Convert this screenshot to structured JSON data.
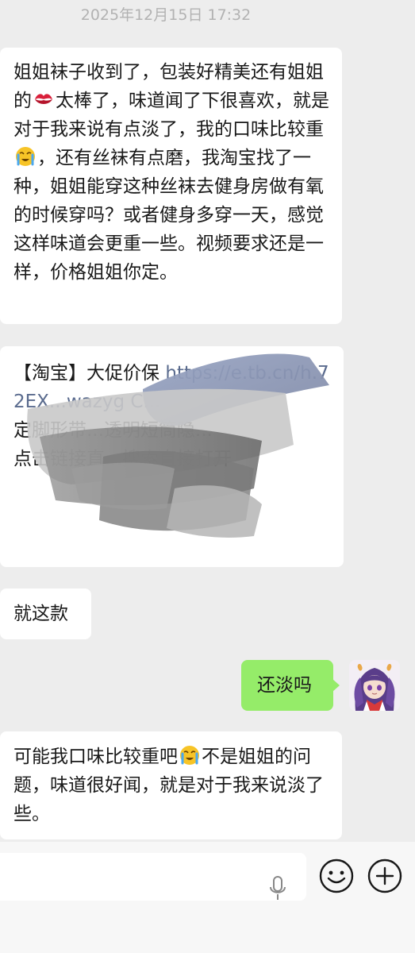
{
  "header": {
    "timestamp": "2025年12月15日 17:32"
  },
  "messages": {
    "m1": {
      "part1": "姐姐袜子收到了，包装好精美还有姐姐的",
      "emoji1": "kiss-mark-emoji",
      "part2": "太棒了，味道闻了下很喜欢，就是对于我来说有点淡了，我的口味比较重",
      "emoji2": "loudly-crying-emoji",
      "part3": "，还有丝袜有点磨，我淘宝找了一种，姐姐能穿这种丝袜去健身房做有氧的时候穿吗？或者健身多穿一天，感觉这样味道会更重一些。视频要求还是一样，价格姐姐你定。"
    },
    "m2": {
      "part1": "【淘宝】大促价保 ",
      "link": "https://e.tb.cn/h.72EX...wazyg C...",
      "part2": "定脚形带...透明短筒隐...",
      "part3": "点击链接直...搜索直接打开"
    },
    "m3": {
      "text": "就这款"
    },
    "m4": {
      "text": "还淡吗"
    },
    "m5": {
      "part1": "可能我口味比较重吧",
      "emoji": "loudly-crying-emoji",
      "part2": "不是姐姐的问题，味道很好闻，就是对于我来说淡了些。"
    }
  },
  "input_bar": {
    "voice_icon": "microphone-icon",
    "emoji_icon": "smiley-icon",
    "plus_icon": "plus-circle-icon"
  },
  "colors": {
    "background": "#ededed",
    "incoming_bubble": "#ffffff",
    "outgoing_bubble": "#95ec69",
    "link": "#5a6b8e",
    "timestamp": "#b2b2b2"
  }
}
